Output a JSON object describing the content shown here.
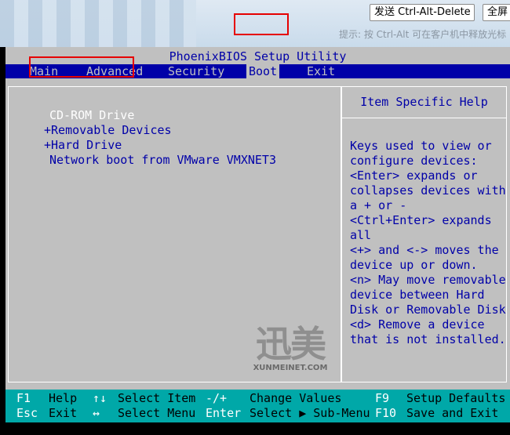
{
  "console": {
    "send_cad_label": "发送 Ctrl-Alt-Delete",
    "fullscreen_label": "全屏",
    "hint": "提示: 按 Ctrl-Alt 可在客户机中释放光标"
  },
  "bios": {
    "title": "PhoenixBIOS Setup Utility",
    "menu": {
      "main": "Main",
      "advanced": "Advanced",
      "security": "Security",
      "boot": "Boot",
      "exit": "Exit"
    },
    "active_menu": "Boot",
    "boot_items": {
      "cdrom": "CD-ROM Drive",
      "removable": "+Removable Devices",
      "hdd": "+Hard Drive",
      "network": "Network boot from VMware VMXNET3"
    },
    "help": {
      "title": "Item Specific Help",
      "lines": [
        "Keys used to view or",
        "configure devices:",
        "<Enter> expands or",
        "collapses devices with",
        "a + or -",
        "<Ctrl+Enter> expands",
        "all",
        "<+> and <-> moves the",
        "device up or down.",
        "<n> May move removable",
        "device between Hard",
        "Disk or Removable Disk",
        "<d> Remove a device",
        "that is not installed."
      ]
    },
    "keys": {
      "row1": [
        "F1",
        "Help",
        "↑↓",
        "Select Item",
        "-/+",
        "Change Values",
        "F9",
        "Setup Defaults"
      ],
      "row2": [
        "Esc",
        "Exit",
        "↔",
        "Select Menu",
        "Enter",
        "Select ▶ Sub-Menu",
        "F10",
        "Save and Exit"
      ]
    }
  },
  "watermark": {
    "logo": "迅美",
    "site": "XUNMEINET.COM"
  },
  "colors": {
    "bios_blue": "#0000a8",
    "bios_gray": "#c0c0c0",
    "keybar_cyan": "#00a8a8",
    "highlight_red": "#e60000"
  }
}
